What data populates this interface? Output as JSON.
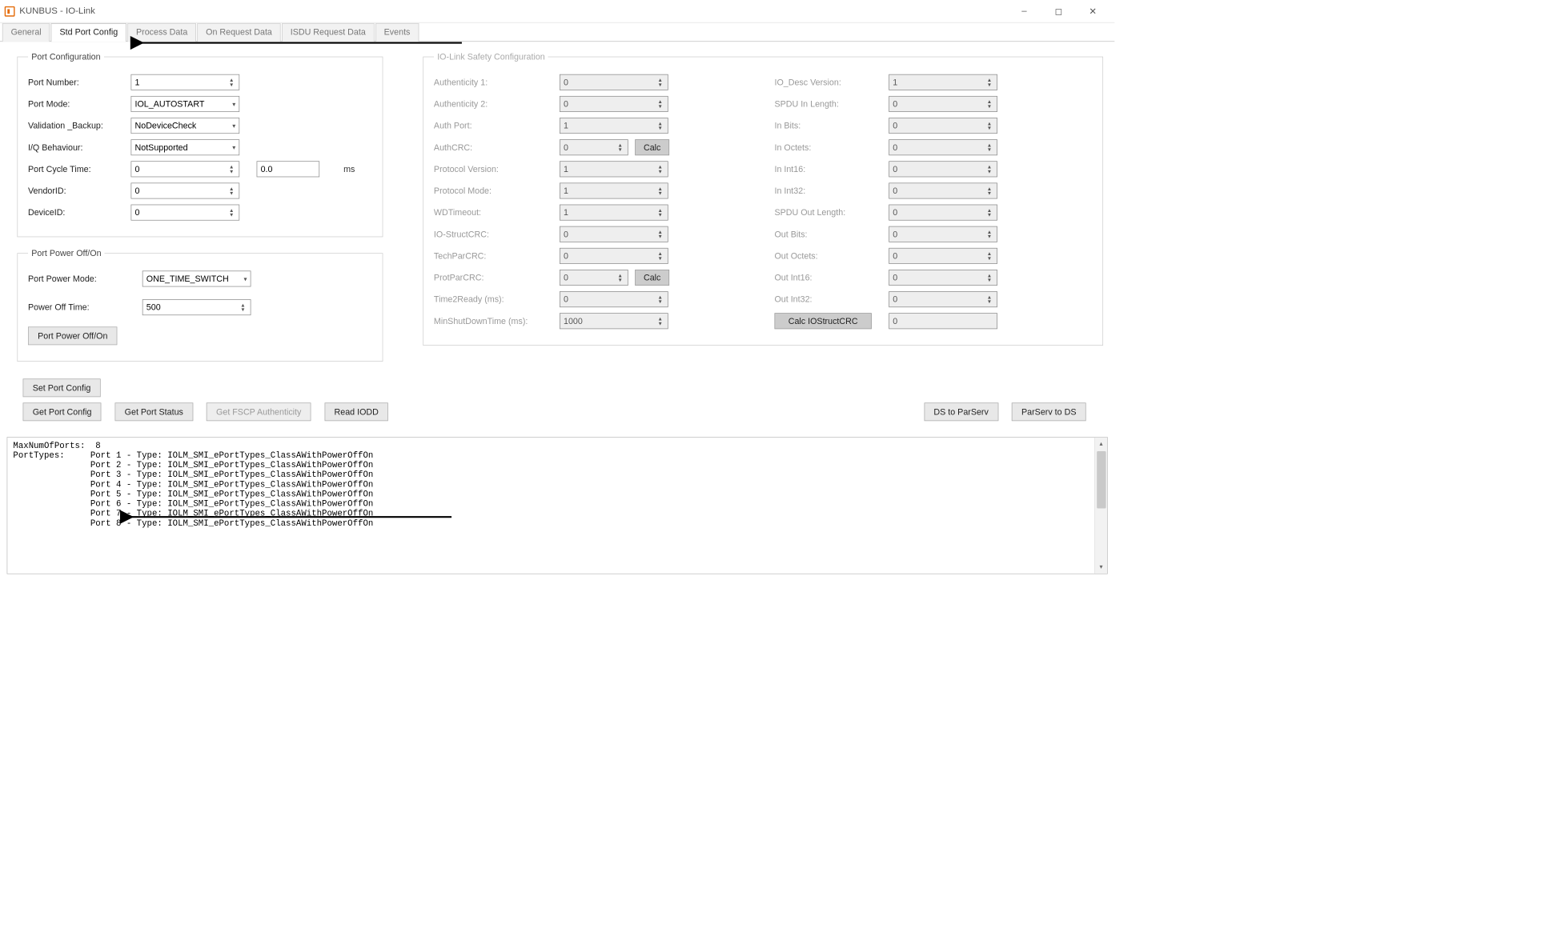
{
  "window": {
    "title": "KUNBUS - IO-Link"
  },
  "tabs": [
    "General",
    "Std Port Config",
    "Process Data",
    "On Request Data",
    "ISDU Request Data",
    "Events"
  ],
  "active_tab": 1,
  "port_config": {
    "legend": "Port Configuration",
    "port_number_label": "Port Number:",
    "port_number": "1",
    "port_mode_label": "Port Mode:",
    "port_mode": "IOL_AUTOSTART",
    "validation_label": "Validation _Backup:",
    "validation": "NoDeviceCheck",
    "iq_label": "I/Q Behaviour:",
    "iq": "NotSupported",
    "cycle_label": "Port Cycle Time:",
    "cycle": "0",
    "cycle_ms": "0.0",
    "cycle_unit": "ms",
    "vendor_label": "VendorID:",
    "vendor": "0",
    "device_label": "DeviceID:",
    "device": "0"
  },
  "port_power": {
    "legend": "Port Power Off/On",
    "mode_label": "Port Power Mode:",
    "mode": "ONE_TIME_SWITCH",
    "off_time_label": "Power Off Time:",
    "off_time": "500",
    "button": "Port Power Off/On"
  },
  "safety": {
    "legend": "IO-Link Safety Configuration",
    "left": [
      {
        "label": "Authenticity 1:",
        "value": "0",
        "calc": false
      },
      {
        "label": "Authenticity 2:",
        "value": "0",
        "calc": false
      },
      {
        "label": "Auth Port:",
        "value": "1",
        "calc": false
      },
      {
        "label": "AuthCRC:",
        "value": "0",
        "calc": true,
        "small": true
      },
      {
        "label": "Protocol Version:",
        "value": "1",
        "calc": false
      },
      {
        "label": "Protocol Mode:",
        "value": "1",
        "calc": false
      },
      {
        "label": "WDTimeout:",
        "value": "1",
        "calc": false
      },
      {
        "label": "IO-StructCRC:",
        "value": "0",
        "calc": false
      },
      {
        "label": "TechParCRC:",
        "value": "0",
        "calc": false
      },
      {
        "label": "ProtParCRC:",
        "value": "0",
        "calc": true,
        "small": true
      },
      {
        "label": "Time2Ready (ms):",
        "value": "0",
        "calc": false
      },
      {
        "label": "MinShutDownTime (ms):",
        "value": "1000",
        "calc": false
      }
    ],
    "right": [
      {
        "label": "IO_Desc Version:",
        "value": "1"
      },
      {
        "label": "SPDU In Length:",
        "value": "0"
      },
      {
        "label": "In Bits:",
        "value": "0"
      },
      {
        "label": "In Octets:",
        "value": "0"
      },
      {
        "label": "In Int16:",
        "value": "0"
      },
      {
        "label": "In Int32:",
        "value": "0"
      },
      {
        "label": "SPDU Out Length:",
        "value": "0"
      },
      {
        "label": "Out Bits:",
        "value": "0"
      },
      {
        "label": "Out Octets:",
        "value": "0"
      },
      {
        "label": "Out Int16:",
        "value": "0"
      },
      {
        "label": "Out Int32:",
        "value": "0"
      }
    ],
    "calc_label": "Calc",
    "calc_struct_label": "Calc IOStructCRC",
    "calc_struct_value": "0"
  },
  "buttons": {
    "set_port_config": "Set Port Config",
    "get_port_config": "Get Port Config",
    "get_port_status": "Get Port Status",
    "get_fscp": "Get FSCP Authenticity",
    "read_iodd": "Read IODD",
    "ds_to_parserv": "DS to ParServ",
    "parserv_to_ds": "ParServ to DS"
  },
  "console": "MaxNumOfPorts:  8\nPortTypes:     Port 1 - Type: IOLM_SMI_ePortTypes_ClassAWithPowerOffOn\n               Port 2 - Type: IOLM_SMI_ePortTypes_ClassAWithPowerOffOn\n               Port 3 - Type: IOLM_SMI_ePortTypes_ClassAWithPowerOffOn\n               Port 4 - Type: IOLM_SMI_ePortTypes_ClassAWithPowerOffOn\n               Port 5 - Type: IOLM_SMI_ePortTypes_ClassAWithPowerOffOn\n               Port 6 - Type: IOLM_SMI_ePortTypes_ClassAWithPowerOffOn\n               Port 7 - Type: IOLM_SMI_ePortTypes_ClassAWithPowerOffOn\n               Port 8 - Type: IOLM_SMI_ePortTypes_ClassAWithPowerOffOn"
}
